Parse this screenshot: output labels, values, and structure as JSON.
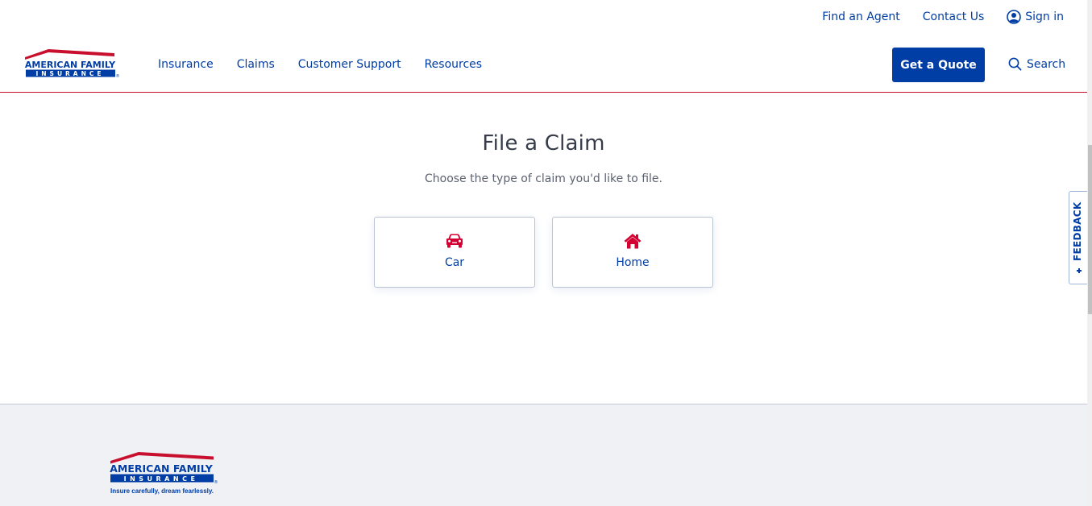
{
  "header": {
    "brand": {
      "line1": "AMERICAN FAMILY",
      "line2": "INSURANCE",
      "mark": "®"
    },
    "utility_nav": [
      {
        "label": "Find an Agent"
      },
      {
        "label": "Contact Us"
      },
      {
        "label": "Sign in",
        "icon": "user-circle-icon"
      }
    ],
    "main_nav": [
      {
        "label": "Insurance"
      },
      {
        "label": "Claims"
      },
      {
        "label": "Customer Support"
      },
      {
        "label": "Resources"
      }
    ],
    "cta_label": "Get a Quote",
    "search_label": "Search",
    "search_icon": "search-icon"
  },
  "main": {
    "title": "File a Claim",
    "subtitle": "Choose the type of claim you'd like to file.",
    "options": [
      {
        "label": "Car",
        "icon": "car-icon"
      },
      {
        "label": "Home",
        "icon": "home-icon"
      }
    ]
  },
  "feedback": {
    "label": "FEEDBACK"
  },
  "footer": {
    "brand": {
      "line1": "AMERICAN FAMILY",
      "line2": "INSURANCE",
      "mark": "®",
      "tagline": "Insure carefully, dream fearlessly."
    }
  },
  "colors": {
    "brand_blue": "#003da5",
    "brand_red": "#c8102e",
    "icon_red": "#d50032",
    "title_gray": "#353b48",
    "footer_bg": "#eff1f4"
  }
}
